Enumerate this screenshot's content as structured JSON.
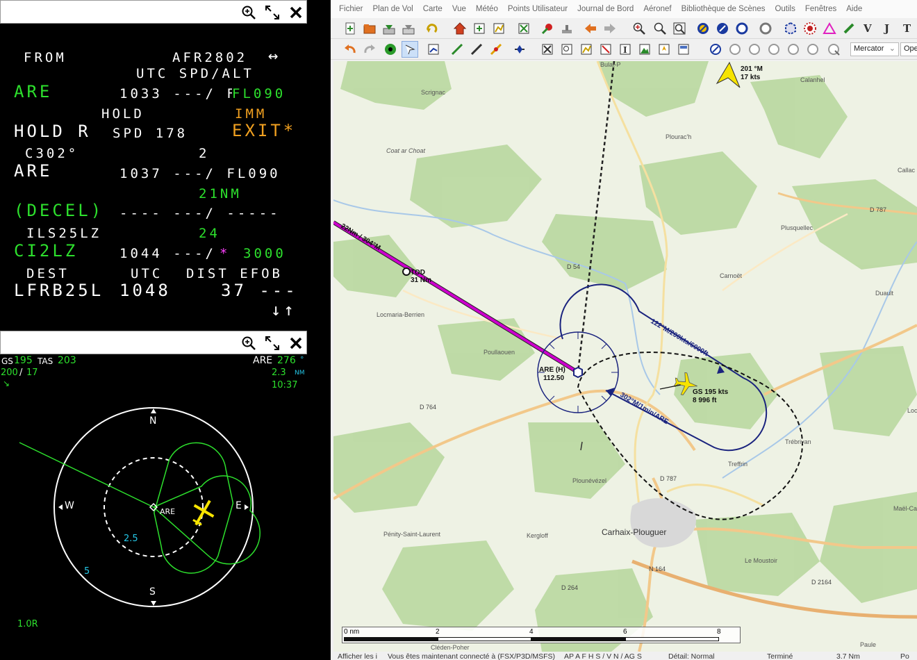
{
  "mcdu": {
    "rows": [
      {
        "text": "FROM",
        "color": "w",
        "size": "sm"
      },
      {
        "text": "AFR2802",
        "color": "w",
        "size": "sm"
      },
      {
        "text": "↔",
        "color": "w",
        "size": "lg"
      },
      {
        "text": "UTC SPD/ALT",
        "color": "w",
        "size": "sm"
      },
      {
        "text": "ARE",
        "color": "g",
        "size": "lg"
      },
      {
        "text": "1033 ---/ FL090",
        "color": "w",
        "size": "sm"
      },
      {
        "text": "FL090",
        "color": "g",
        "size": "sm"
      },
      {
        "text": "HOLD",
        "color": "w",
        "size": "sm"
      },
      {
        "text": "IMM",
        "color": "o",
        "size": "sm"
      },
      {
        "text": "HOLD R",
        "color": "w",
        "size": "lg"
      },
      {
        "text": "SPD 178",
        "color": "w",
        "size": "sm"
      },
      {
        "text": "EXIT*",
        "color": "o",
        "size": "lg"
      },
      {
        "text": "C302°",
        "color": "w",
        "size": "sm"
      },
      {
        "text": "2",
        "color": "w",
        "size": "sm"
      },
      {
        "text": "ARE",
        "color": "w",
        "size": "lg"
      },
      {
        "text": "1037 ---/ FL090",
        "color": "w",
        "size": "sm"
      },
      {
        "text": "21NM",
        "color": "g",
        "size": "sm"
      },
      {
        "text": "(DECEL)",
        "color": "g",
        "size": "lg"
      },
      {
        "text": "---- ---/ -----",
        "color": "w",
        "size": "sm"
      },
      {
        "text": "ILS25LZ",
        "color": "w",
        "size": "sm"
      },
      {
        "text": "24",
        "color": "g",
        "size": "sm"
      },
      {
        "text": "CI2LZ",
        "color": "g",
        "size": "lg"
      },
      {
        "text": "1044 ---/",
        "color": "w",
        "size": "sm"
      },
      {
        "text": "*",
        "color": "m",
        "size": "sm"
      },
      {
        "text": "3000",
        "color": "g",
        "size": "sm"
      },
      {
        "text": "DEST",
        "color": "w",
        "size": "sm"
      },
      {
        "text": "UTC",
        "color": "w",
        "size": "sm"
      },
      {
        "text": "DIST EFOB",
        "color": "w",
        "size": "sm"
      },
      {
        "text": "LFRB25L",
        "color": "w",
        "size": "lg"
      },
      {
        "text": "1048",
        "color": "w",
        "size": "lg"
      },
      {
        "text": "37 ---",
        "color": "w",
        "size": "lg"
      },
      {
        "text": "↓↑",
        "color": "w",
        "size": "lg"
      }
    ]
  },
  "nd": {
    "gs_label": "GS",
    "gs": "195",
    "tas_label": "TAS",
    "tas": "203",
    "wind": "200",
    "wind_sep": "/",
    "wind_speed": "17",
    "wind_arrow": "↘",
    "wpt": "ARE",
    "wpt_brg": "276",
    "deg": "°",
    "wpt_dist": "2.3",
    "nm": "NM",
    "eta": "10:37",
    "north": "N",
    "south": "S",
    "east": "E",
    "west": "W",
    "wpt_label": "ARE",
    "range_inner": "2.5",
    "range_outer": "5",
    "version": "1.0R"
  },
  "menus": [
    "Fichier",
    "Plan de Vol",
    "Carte",
    "Vue",
    "Météo",
    "Points Utilisateur",
    "Journal de Bord",
    "Aéronef",
    "Bibliothèque de Scènes",
    "Outils",
    "Fenêtres",
    "Aide"
  ],
  "toolbar": {
    "projection": "Mercator",
    "projection_arrow": "⌄",
    "extra": "Ope"
  },
  "map": {
    "wind_dir": "201 °M",
    "wind_speed": "17 kts",
    "leg_inbound": "22Nm / 304°M",
    "tod": "TOD",
    "tod_dist": "31 Nm",
    "nav_name": "ARE (H)",
    "nav_freq": "112.50",
    "hold_out": "122°M/200kts/6000ft",
    "hold_in": "302°M/1min/ARE",
    "ac_gs": "GS 195 kts",
    "ac_alt": "8 996 ft",
    "places": [
      "Scrignac",
      "Calanhel",
      "Plourac'h",
      "Callac",
      "Coat ar Choat",
      "D 787",
      "Plusquellec",
      "D 54",
      "Carnoët",
      "Duault",
      "Locmaria-Berrien",
      "Poullaouen",
      "D 764",
      "Loca",
      "Trébrivan",
      "Treffrin",
      "Plounévézel",
      "D 787",
      "Maël-Ca",
      "Kergloff",
      "Carhaix-Plouguer",
      "Pénity-Saint-Laurent",
      "Le Moustoir",
      "N 164",
      "D 264",
      "D 2164",
      "Cléden-Poher",
      "Paule",
      "Bulat-P"
    ],
    "scale": [
      "0 nm",
      "2",
      "4",
      "6",
      "8"
    ]
  },
  "status": [
    "Afficher les i",
    "Vous êtes maintenant connecté à (FSX/P3D/MSFS)",
    "AP A F H S / V N / AG S",
    "Détail: Normal",
    "Terminé",
    "3.7 Nm",
    "Po"
  ],
  "colors": {
    "mcdu_green": "#2de02d",
    "mcdu_amber": "#f0a020",
    "mcdu_magenta": "#ff40ff",
    "hold_blue": "#1a237e",
    "route_magenta": "#cc00cc",
    "aircraft_yellow": "#f7e400"
  }
}
